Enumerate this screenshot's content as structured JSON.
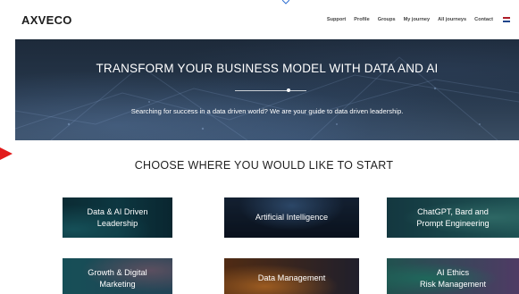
{
  "brand": {
    "logo_text": "AXVECO"
  },
  "nav": {
    "items": [
      {
        "label": "Support"
      },
      {
        "label": "Profile"
      },
      {
        "label": "Groups"
      },
      {
        "label": "My journey"
      },
      {
        "label": "All journeys"
      },
      {
        "label": "Contact"
      }
    ],
    "language_flag": "dutch-flag-icon"
  },
  "hero": {
    "title": "TRANSFORM YOUR BUSINESS MODEL WITH DATA AND AI",
    "subtitle": "Searching for success in a data driven world?  We are your guide to data driven leadership."
  },
  "section": {
    "title": "CHOOSE WHERE YOU WOULD LIKE TO START"
  },
  "cards": [
    {
      "line1": "Data & AI Driven",
      "line2": "Leadership"
    },
    {
      "line1": "Artificial Intelligence",
      "line2": ""
    },
    {
      "line1": "ChatGPT, Bard and",
      "line2": "Prompt Engineering"
    },
    {
      "line1": "Growth & Digital",
      "line2": "Marketing"
    },
    {
      "line1": "Data Management",
      "line2": ""
    },
    {
      "line1": "AI Ethics",
      "line2": "Risk Management"
    }
  ],
  "colors": {
    "accent_arrow": "#e21b1b",
    "hero_background": "#26374b",
    "text_dark": "#1f1f1f"
  }
}
